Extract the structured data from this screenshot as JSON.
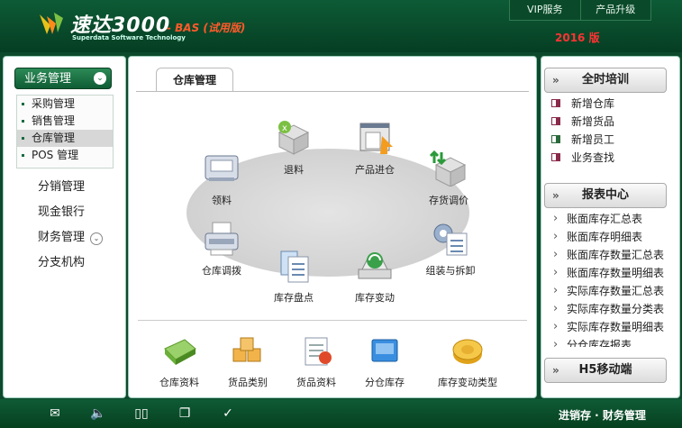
{
  "header": {
    "logo_text": "速达3000",
    "logo_subtitle": "Superdata Software Technology",
    "edition": "- BAS (试用版)",
    "vip_label": "VIP服务",
    "upgrade_label": "产品升级",
    "year": "2016 版"
  },
  "sidebar": {
    "section": "业务管理",
    "sub_items": [
      "采购管理",
      "销售管理",
      "仓库管理",
      "POS 管理"
    ],
    "nav": [
      "分销管理",
      "现金银行",
      "财务管理",
      "分支机构"
    ]
  },
  "main": {
    "tab": "仓库管理",
    "flow": [
      "领料",
      "退料",
      "产品进仓",
      "存货调价",
      "仓库调拨",
      "库存盘点",
      "库存变动",
      "组装与拆卸"
    ],
    "bottom": [
      "仓库资料",
      "货品类别",
      "货品资料",
      "分仓库存",
      "库存变动类型"
    ]
  },
  "right": {
    "training_title": "全时培训",
    "training_items": [
      "新增仓库",
      "新增货品",
      "新增员工",
      "业务查找"
    ],
    "report_title": "报表中心",
    "report_items": [
      "账面库存汇总表",
      "账面库存明细表",
      "账面库存数量汇总表",
      "账面库存数量明细表",
      "实际库存数量汇总表",
      "实际库存数量分类表",
      "实际库存数量明细表",
      "分仓库存报表"
    ],
    "mobile_title": "H5移动端"
  },
  "footer": {
    "title": "进销存 · 财务管理"
  },
  "colors": {
    "brand_green": "#0d5b36",
    "accent_red": "#ff3333",
    "edition_orange": "#ff5a2a"
  }
}
